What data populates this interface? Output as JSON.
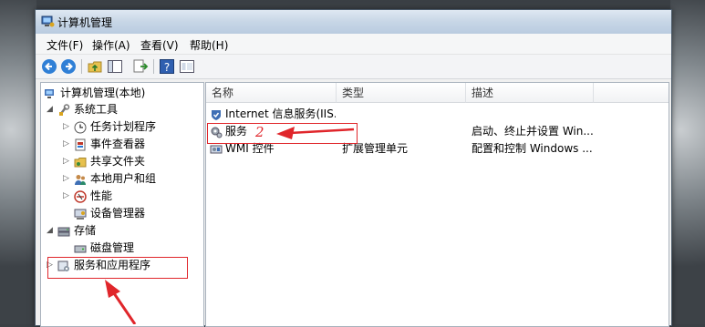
{
  "window": {
    "title": "计算机管理"
  },
  "menu": [
    {
      "label": "文件(F)"
    },
    {
      "label": "操作(A)"
    },
    {
      "label": "查看(V)"
    },
    {
      "label": "帮助(H)"
    }
  ],
  "toolbar": {
    "icons": [
      "back-arrow-icon",
      "forward-arrow-icon",
      "up-folder-icon",
      "show-hide-tree-icon",
      "export-list-icon",
      "help-icon",
      "properties-icon"
    ]
  },
  "tree": [
    {
      "label": "计算机管理(本地)",
      "icon": "computer-management-icon",
      "expander": ""
    },
    {
      "label": "系统工具",
      "icon": "system-tools-icon",
      "expander": "◢"
    },
    {
      "label": "任务计划程序",
      "icon": "clock-icon",
      "expander": "▷"
    },
    {
      "label": "事件查看器",
      "icon": "event-viewer-icon",
      "expander": "▷"
    },
    {
      "label": "共享文件夹",
      "icon": "shared-folder-icon",
      "expander": "▷"
    },
    {
      "label": "本地用户和组",
      "icon": "users-icon",
      "expander": "▷"
    },
    {
      "label": "性能",
      "icon": "performance-icon",
      "expander": "▷"
    },
    {
      "label": "设备管理器",
      "icon": "device-manager-icon",
      "expander": ""
    },
    {
      "label": "存储",
      "icon": "storage-icon",
      "expander": "◢"
    },
    {
      "label": "磁盘管理",
      "icon": "disk-icon",
      "expander": ""
    },
    {
      "label": "服务和应用程序",
      "icon": "services-apps-icon",
      "expander": "▷"
    }
  ],
  "columns": [
    "名称",
    "类型",
    "描述"
  ],
  "rows": [
    {
      "name": "Internet 信息服务(IIS...",
      "type": "",
      "desc": "",
      "icon": "iis-icon"
    },
    {
      "name": "服务",
      "type": "",
      "desc": "启动、终止并设置 Win...",
      "icon": "services-gear-icon"
    },
    {
      "name": "WMI 控件",
      "type": "扩展管理单元",
      "desc": "配置和控制 Windows ...",
      "icon": "wmi-icon"
    }
  ],
  "annotations": {
    "step_number": "2",
    "color": "#e0262b"
  }
}
